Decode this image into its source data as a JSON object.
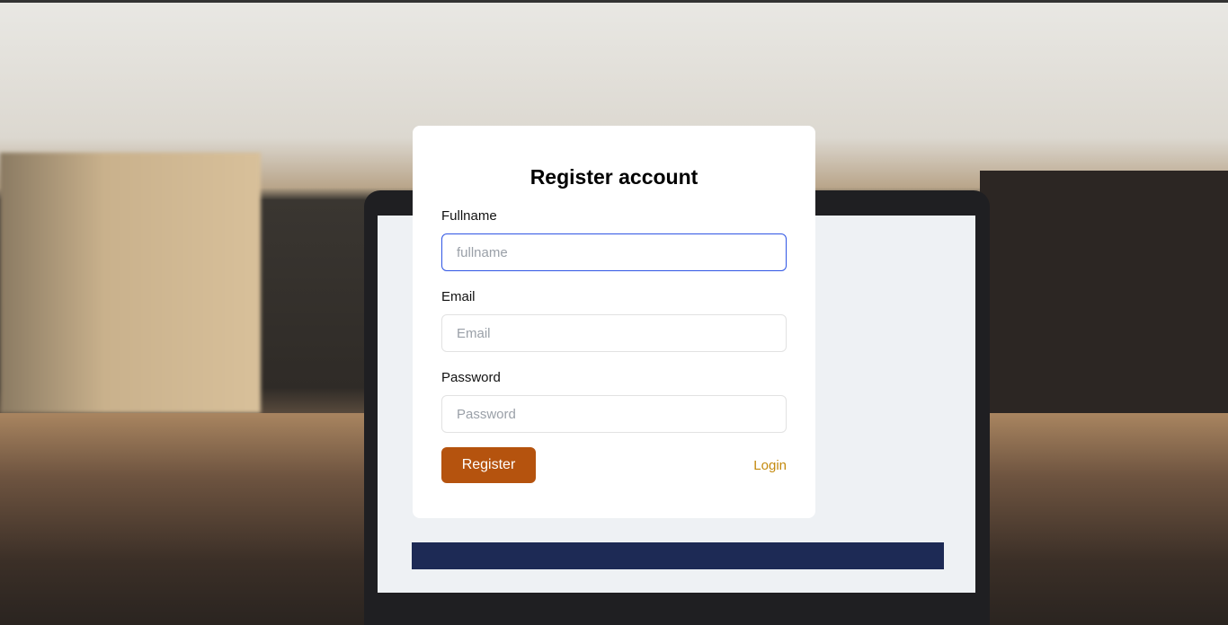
{
  "form": {
    "title": "Register account",
    "fullname": {
      "label": "Fullname",
      "placeholder": "fullname",
      "value": ""
    },
    "email": {
      "label": "Email",
      "placeholder": "Email",
      "value": ""
    },
    "password": {
      "label": "Password",
      "placeholder": "Password",
      "value": ""
    },
    "register_label": "Register",
    "login_label": "Login"
  },
  "colors": {
    "primary_button": "#b5530e",
    "link": "#c48a0e",
    "focus_border": "#2f55e4"
  }
}
